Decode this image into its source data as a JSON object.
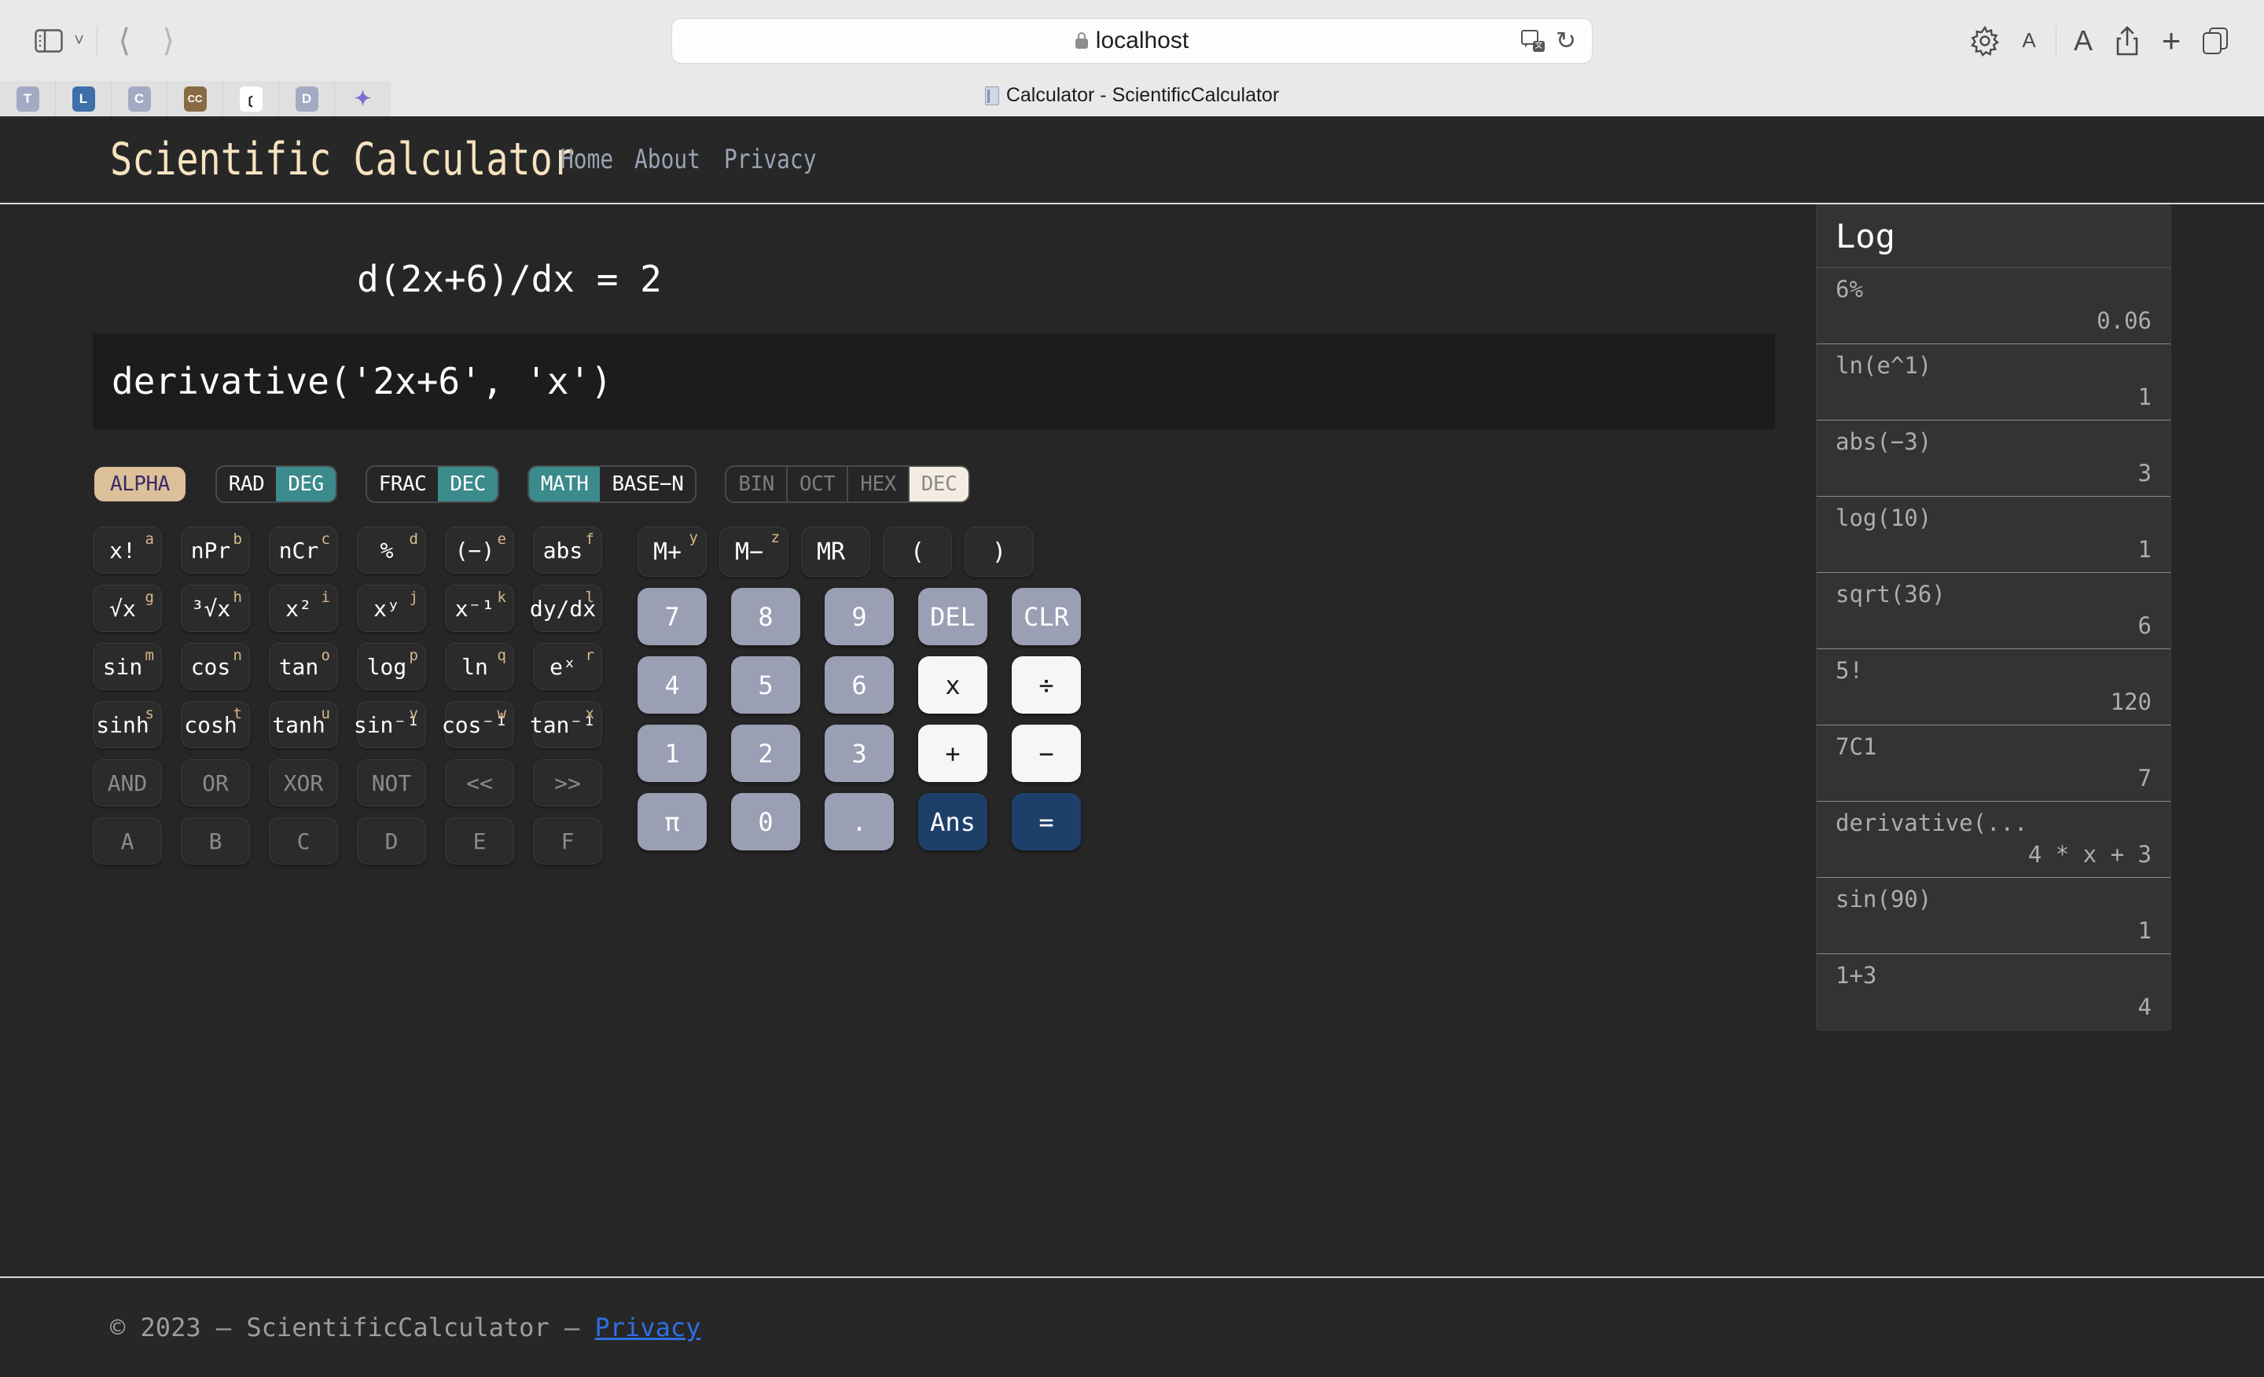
{
  "browser": {
    "url": "localhost",
    "tab_title": "Calculator - ScientificCalculator",
    "extensions": [
      {
        "letter": "T",
        "bg": "#a3abc4"
      },
      {
        "letter": "L",
        "bg": "#3f6fa8"
      },
      {
        "letter": "C",
        "bg": "#a3abc4"
      },
      {
        "letter": "CC",
        "bg": "#8a6a42"
      },
      {
        "letter": "()",
        "bg": "#151515"
      },
      {
        "letter": "D",
        "bg": "#a3abc4"
      },
      {
        "letter": "✦",
        "bg": "#ffffff"
      }
    ]
  },
  "navbar": {
    "brand": "Scientific Calculator",
    "links": [
      "Home",
      "About",
      "Privacy"
    ]
  },
  "display": {
    "result": "d(2x+6)/dx = 2",
    "expression": "derivative('2x+6', 'x')"
  },
  "toggles": {
    "alpha": {
      "label": "ALPHA",
      "active": true
    },
    "angle": [
      {
        "label": "RAD",
        "active": false
      },
      {
        "label": "DEG",
        "active": true
      }
    ],
    "fraction": [
      {
        "label": "FRAC",
        "active": false
      },
      {
        "label": "DEC",
        "active": true
      }
    ],
    "mode": [
      {
        "label": "MATH",
        "active": true
      },
      {
        "label": "BASE−N",
        "active": false
      }
    ],
    "base": [
      {
        "label": "BIN",
        "active": false
      },
      {
        "label": "OCT",
        "active": false
      },
      {
        "label": "HEX",
        "active": false
      },
      {
        "label": "DEC",
        "active": true
      }
    ]
  },
  "function_keys": [
    {
      "label": "x!",
      "sup": "a",
      "disabled": false
    },
    {
      "label": "nPr",
      "sup": "b",
      "disabled": false
    },
    {
      "label": "nCr",
      "sup": "c",
      "disabled": false
    },
    {
      "label": "%",
      "sup": "d",
      "disabled": false
    },
    {
      "label": "(−)",
      "sup": "e",
      "disabled": false
    },
    {
      "label": "abs",
      "sup": "f",
      "disabled": false
    },
    {
      "label": "√x",
      "sup": "g",
      "disabled": false
    },
    {
      "label": "³√x",
      "sup": "h",
      "disabled": false
    },
    {
      "label": "x²",
      "sup": "i",
      "disabled": false
    },
    {
      "label": "xʸ",
      "sup": "j",
      "disabled": false
    },
    {
      "label": "x⁻¹",
      "sup": "k",
      "disabled": false
    },
    {
      "label": "dy/dx",
      "sup": "l",
      "disabled": false
    },
    {
      "label": "sin",
      "sup": "m",
      "disabled": false
    },
    {
      "label": "cos",
      "sup": "n",
      "disabled": false
    },
    {
      "label": "tan",
      "sup": "o",
      "disabled": false
    },
    {
      "label": "log",
      "sup": "p",
      "disabled": false
    },
    {
      "label": "ln",
      "sup": "q",
      "disabled": false
    },
    {
      "label": "eˣ",
      "sup": "r",
      "disabled": false
    },
    {
      "label": "sinh",
      "sup": "s",
      "disabled": false
    },
    {
      "label": "cosh",
      "sup": "t",
      "disabled": false
    },
    {
      "label": "tanh",
      "sup": "u",
      "disabled": false
    },
    {
      "label": "sin⁻¹",
      "sup": "v",
      "disabled": false
    },
    {
      "label": "cos⁻¹",
      "sup": "w",
      "disabled": false
    },
    {
      "label": "tan⁻¹",
      "sup": "x",
      "disabled": false
    },
    {
      "label": "AND",
      "sup": "",
      "disabled": true
    },
    {
      "label": "OR",
      "sup": "",
      "disabled": true
    },
    {
      "label": "XOR",
      "sup": "",
      "disabled": true
    },
    {
      "label": "NOT",
      "sup": "",
      "disabled": true
    },
    {
      "label": "<<",
      "sup": "",
      "disabled": true
    },
    {
      "label": ">>",
      "sup": "",
      "disabled": true
    },
    {
      "label": "A",
      "sup": "",
      "disabled": true
    },
    {
      "label": "B",
      "sup": "",
      "disabled": true
    },
    {
      "label": "C",
      "sup": "",
      "disabled": true
    },
    {
      "label": "D",
      "sup": "",
      "disabled": true
    },
    {
      "label": "E",
      "sup": "",
      "disabled": true
    },
    {
      "label": "F",
      "sup": "",
      "disabled": true
    }
  ],
  "memory_keys": [
    {
      "label": "M+",
      "sup": "y"
    },
    {
      "label": "M−",
      "sup": "z"
    },
    {
      "label": "MR",
      "sup": ""
    },
    {
      "label": "(",
      "sup": ""
    },
    {
      "label": ")",
      "sup": ""
    }
  ],
  "number_keys": [
    {
      "label": "7",
      "style": "num"
    },
    {
      "label": "8",
      "style": "num"
    },
    {
      "label": "9",
      "style": "num"
    },
    {
      "label": "DEL",
      "style": "num"
    },
    {
      "label": "CLR",
      "style": "num"
    },
    {
      "label": "4",
      "style": "num"
    },
    {
      "label": "5",
      "style": "num"
    },
    {
      "label": "6",
      "style": "num"
    },
    {
      "label": "x",
      "style": "op"
    },
    {
      "label": "÷",
      "style": "op"
    },
    {
      "label": "1",
      "style": "num"
    },
    {
      "label": "2",
      "style": "num"
    },
    {
      "label": "3",
      "style": "num"
    },
    {
      "label": "+",
      "style": "op"
    },
    {
      "label": "−",
      "style": "op"
    },
    {
      "label": "π",
      "style": "num"
    },
    {
      "label": "0",
      "style": "num"
    },
    {
      "label": ".",
      "style": "num"
    },
    {
      "label": "Ans",
      "style": "accent"
    },
    {
      "label": "=",
      "style": "accent"
    }
  ],
  "log": {
    "title": "Log",
    "entries": [
      {
        "expr": "6%",
        "result": "0.06"
      },
      {
        "expr": "ln(e^1)",
        "result": "1"
      },
      {
        "expr": "abs(−3)",
        "result": "3"
      },
      {
        "expr": "log(10)",
        "result": "1"
      },
      {
        "expr": "sqrt(36)",
        "result": "6"
      },
      {
        "expr": "5!",
        "result": "120"
      },
      {
        "expr": "7C1",
        "result": "7"
      },
      {
        "expr": "derivative(...",
        "result": "4 * x + 3"
      },
      {
        "expr": "sin(90)",
        "result": "1"
      },
      {
        "expr": "1+3",
        "result": "4"
      }
    ]
  },
  "footer": {
    "text": "© 2023 — ScientificCalculator — ",
    "link": "Privacy"
  },
  "colors": {
    "accent_teal": "#3b8a8c",
    "alpha_tan": "#dcc09a",
    "num_slate": "#9a9fb4",
    "ans_navy": "#1f3f6b",
    "brand_cream": "#f7e3c0"
  }
}
